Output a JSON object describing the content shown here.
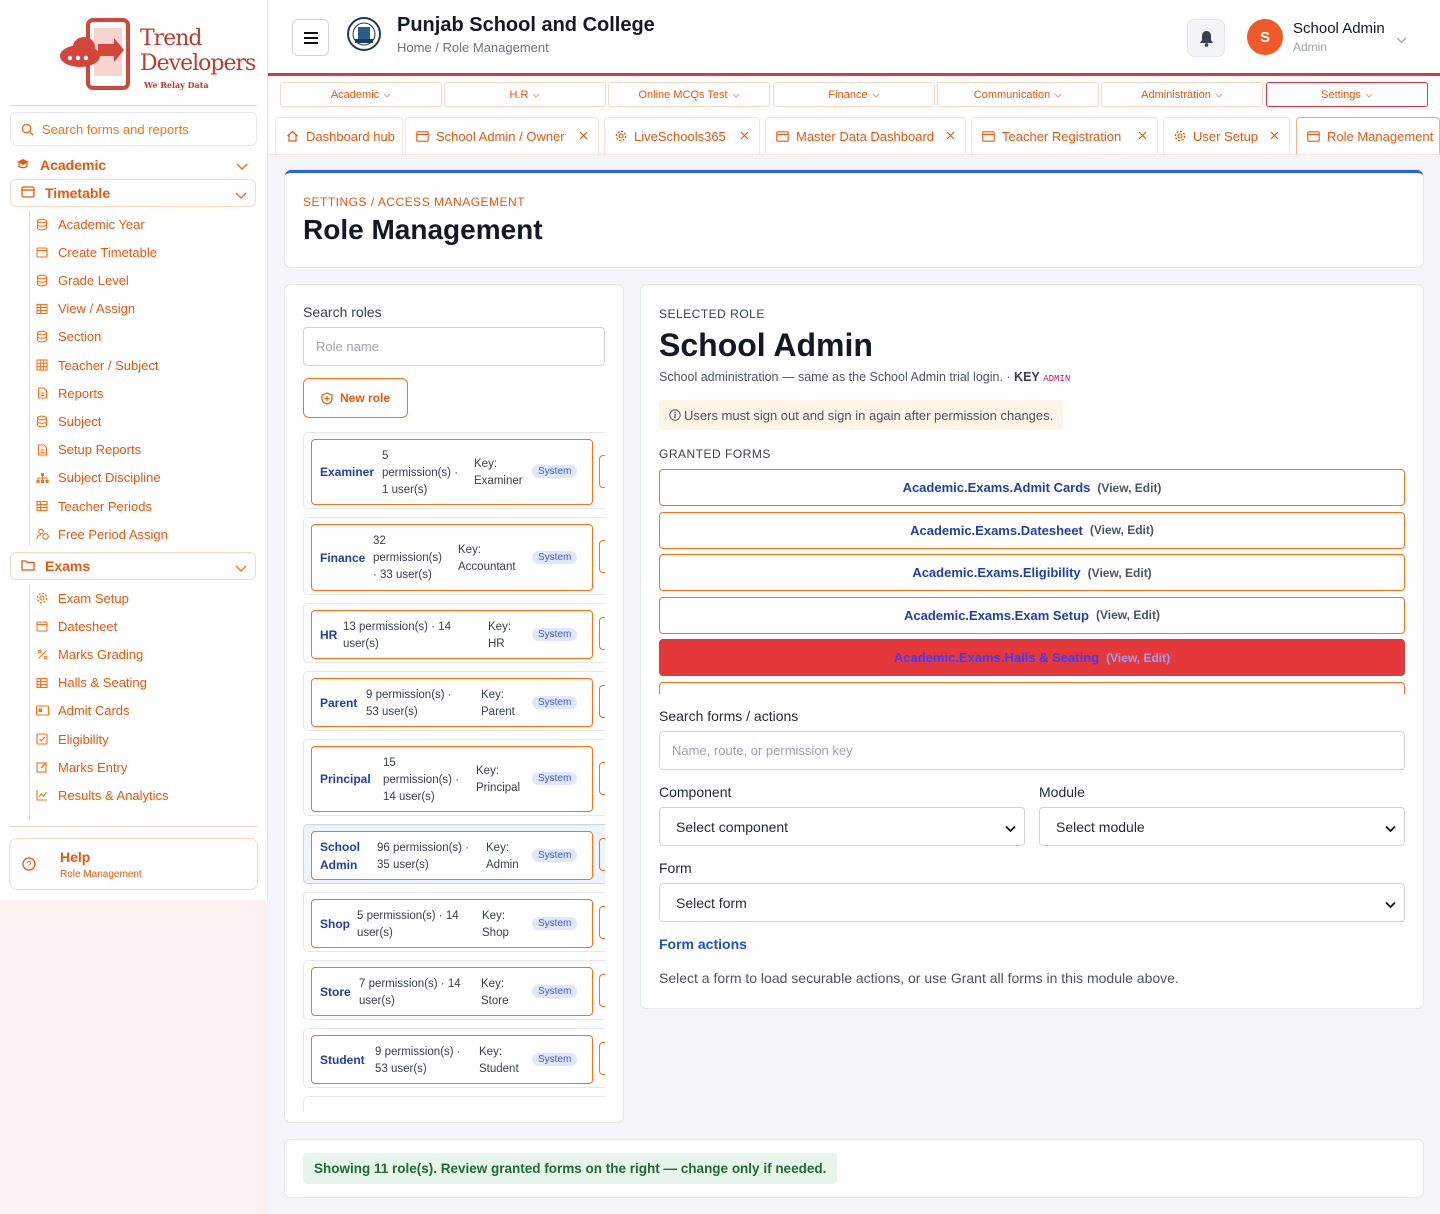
{
  "brand": {
    "line1": "Trend",
    "line2": "Developers",
    "tagline": "We Relay Data",
    "color": "#c0392b"
  },
  "sidebar": {
    "search_placeholder": "Search forms and reports",
    "academic_label": "Academic",
    "timetable": {
      "label": "Timetable",
      "items": [
        {
          "label": "Academic Year",
          "icon": "database-icon"
        },
        {
          "label": "Create Timetable",
          "icon": "calendar-icon"
        },
        {
          "label": "Grade Level",
          "icon": "database-icon"
        },
        {
          "label": "View / Assign",
          "icon": "table-icon"
        },
        {
          "label": "Section",
          "icon": "database-icon"
        },
        {
          "label": "Teacher / Subject",
          "icon": "grid-icon"
        },
        {
          "label": "Reports",
          "icon": "document-icon"
        },
        {
          "label": "Subject",
          "icon": "database-icon"
        },
        {
          "label": "Setup Reports",
          "icon": "document-icon"
        },
        {
          "label": "Subject Discipline",
          "icon": "sitemap-icon"
        },
        {
          "label": "Teacher Periods",
          "icon": "table-icon"
        },
        {
          "label": "Free Period Assign",
          "icon": "user-clock-icon"
        }
      ]
    },
    "exams": {
      "label": "Exams",
      "items": [
        {
          "label": "Exam Setup",
          "icon": "gear-icon"
        },
        {
          "label": "Datesheet",
          "icon": "calendar-icon"
        },
        {
          "label": "Marks Grading",
          "icon": "percent-icon"
        },
        {
          "label": "Halls & Seating",
          "icon": "table-icon"
        },
        {
          "label": "Admit Cards",
          "icon": "id-card-icon"
        },
        {
          "label": "Eligibility",
          "icon": "check-square-icon"
        },
        {
          "label": "Marks Entry",
          "icon": "edit-icon"
        },
        {
          "label": "Results & Analytics",
          "icon": "chart-line-icon"
        }
      ]
    },
    "help": {
      "title": "Help",
      "subtitle": "Role Management"
    }
  },
  "header": {
    "school_name": "Punjab School and College",
    "breadcrumb": "Home / Role Management",
    "user_initial": "S",
    "user_name": "School Admin",
    "user_role": "Admin"
  },
  "modules": [
    {
      "label": "Academic"
    },
    {
      "label": "H.R"
    },
    {
      "label": "Online MCQs Test"
    },
    {
      "label": "Finance"
    },
    {
      "label": "Communication"
    },
    {
      "label": "Administration"
    },
    {
      "label": "Settings",
      "active": true
    }
  ],
  "tabs": [
    {
      "label": "Dashboard hub",
      "icon": "home-icon",
      "closable": false
    },
    {
      "label": "School Admin / Owner",
      "icon": "window-icon",
      "closable": true
    },
    {
      "label": "LiveSchools365",
      "icon": "gear-icon",
      "closable": true
    },
    {
      "label": "Master Data Dashboard",
      "icon": "window-icon",
      "closable": true
    },
    {
      "label": "Teacher Registration",
      "icon": "window-icon",
      "closable": true
    },
    {
      "label": "User Setup",
      "icon": "gear-icon",
      "closable": true
    },
    {
      "label": "Role Management",
      "icon": "window-icon",
      "closable": false,
      "active": true
    }
  ],
  "page": {
    "crumb": "SETTINGS / ACCESS MANAGEMENT",
    "title": "Role Management"
  },
  "roles_panel": {
    "search_label": "Search roles",
    "search_placeholder": "Role name",
    "new_role_label": "New role",
    "roles": [
      {
        "name": "Examiner",
        "perm_lines": [
          "5",
          "permission(s) ·",
          "1 user(s)"
        ],
        "key_lines": [
          "Key:",
          "Examiner"
        ],
        "badge": "System"
      },
      {
        "name": "Finance",
        "perm_lines": [
          "32",
          "permission(s)",
          "· 33 user(s)"
        ],
        "key_lines": [
          "Key:",
          "Accountant"
        ],
        "badge": "System"
      },
      {
        "name": "HR",
        "perm_lines": [
          "13 permission(s) · 14",
          "user(s)"
        ],
        "key_lines": [
          "Key:",
          "HR"
        ],
        "badge": "System"
      },
      {
        "name": "Parent",
        "perm_lines": [
          "9 permission(s) ·",
          "53 user(s)"
        ],
        "key_lines": [
          "Key:",
          "Parent"
        ],
        "badge": "System"
      },
      {
        "name": "Principal",
        "perm_lines": [
          "15",
          "permission(s) ·",
          "14 user(s)"
        ],
        "key_lines": [
          "Key:",
          "Principal"
        ],
        "badge": "System"
      },
      {
        "name": "School Admin",
        "perm_lines": [
          "96 permission(s) ·",
          "35 user(s)"
        ],
        "key_lines": [
          "Key:",
          "Admin"
        ],
        "badge": "System",
        "selected": true
      },
      {
        "name": "Shop",
        "perm_lines": [
          "5 permission(s) · 14",
          "user(s)"
        ],
        "key_lines": [
          "Key:",
          "Shop"
        ],
        "badge": "System"
      },
      {
        "name": "Store",
        "perm_lines": [
          "7 permission(s) · 14",
          "user(s)"
        ],
        "key_lines": [
          "Key:",
          "Store"
        ],
        "badge": "System"
      },
      {
        "name": "Student",
        "perm_lines": [
          "9 permission(s) ·",
          "53 user(s)"
        ],
        "key_lines": [
          "Key:",
          "Student"
        ],
        "badge": "System"
      }
    ]
  },
  "selected_role": {
    "label": "SELECTED ROLE",
    "name": "School Admin",
    "description": "School administration — same as the School Admin trial login. ·",
    "key_label": "KEY",
    "key_value": "ADMIN",
    "note": "Users must sign out and sign in again after permission changes.",
    "granted_label": "GRANTED FORMS",
    "granted_forms": [
      {
        "form": "Academic.Exams.Admit Cards",
        "actions": "(View, Edit)"
      },
      {
        "form": "Academic.Exams.Datesheet",
        "actions": "(View, Edit)"
      },
      {
        "form": "Academic.Exams.Eligibility",
        "actions": "(View, Edit)"
      },
      {
        "form": "Academic.Exams.Exam Setup",
        "actions": "(View, Edit)"
      },
      {
        "form": "Academic.Exams.Halls & Seating",
        "actions": "(View, Edit)",
        "highlighted": true
      }
    ],
    "search_forms_label": "Search forms / actions",
    "search_forms_placeholder": "Name, route, or permission key",
    "component_label": "Component",
    "component_value": "Select component",
    "module_label": "Module",
    "module_value": "Select module",
    "form_label": "Form",
    "form_value": "Select form",
    "form_actions_title": "Form actions",
    "form_actions_text": "Select a form to load securable actions, or use Grant all forms in this module above."
  },
  "footer": {
    "message": "Showing 11 role(s). Review granted forms on the right — change only if needed."
  }
}
